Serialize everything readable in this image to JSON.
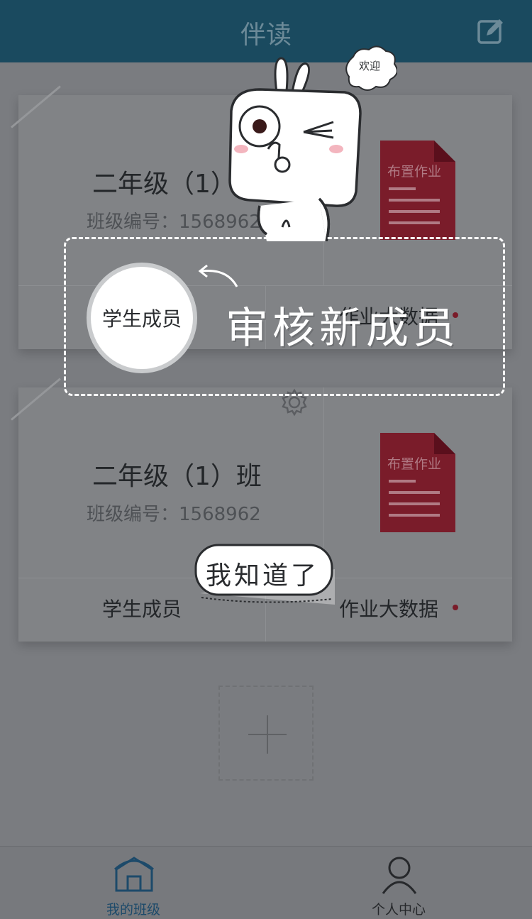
{
  "header": {
    "title": "伴读",
    "edit_icon": "edit-icon"
  },
  "classes": [
    {
      "name": "二年级（1）班",
      "code_label": "班级编号：1568962",
      "assign_label": "布置作业",
      "members_label": "学生成员",
      "stats_label": "作业大数据"
    },
    {
      "name": "二年级（1）班",
      "code_label": "班级编号：1568962",
      "assign_label": "布置作业",
      "members_label": "学生成员",
      "stats_label": "作业大数据"
    }
  ],
  "nav": {
    "home_label": "我的班级",
    "me_label": "个人中心"
  },
  "guide": {
    "bubble_text": "欢迎",
    "circle_label": "学生成员",
    "hint": "审核新成员",
    "dismiss_label": "我知道了"
  },
  "colors": {
    "header_bg": "#1a4a5f",
    "doc_red": "#7a1c2a",
    "overlay_bg": "#7a7c80"
  }
}
